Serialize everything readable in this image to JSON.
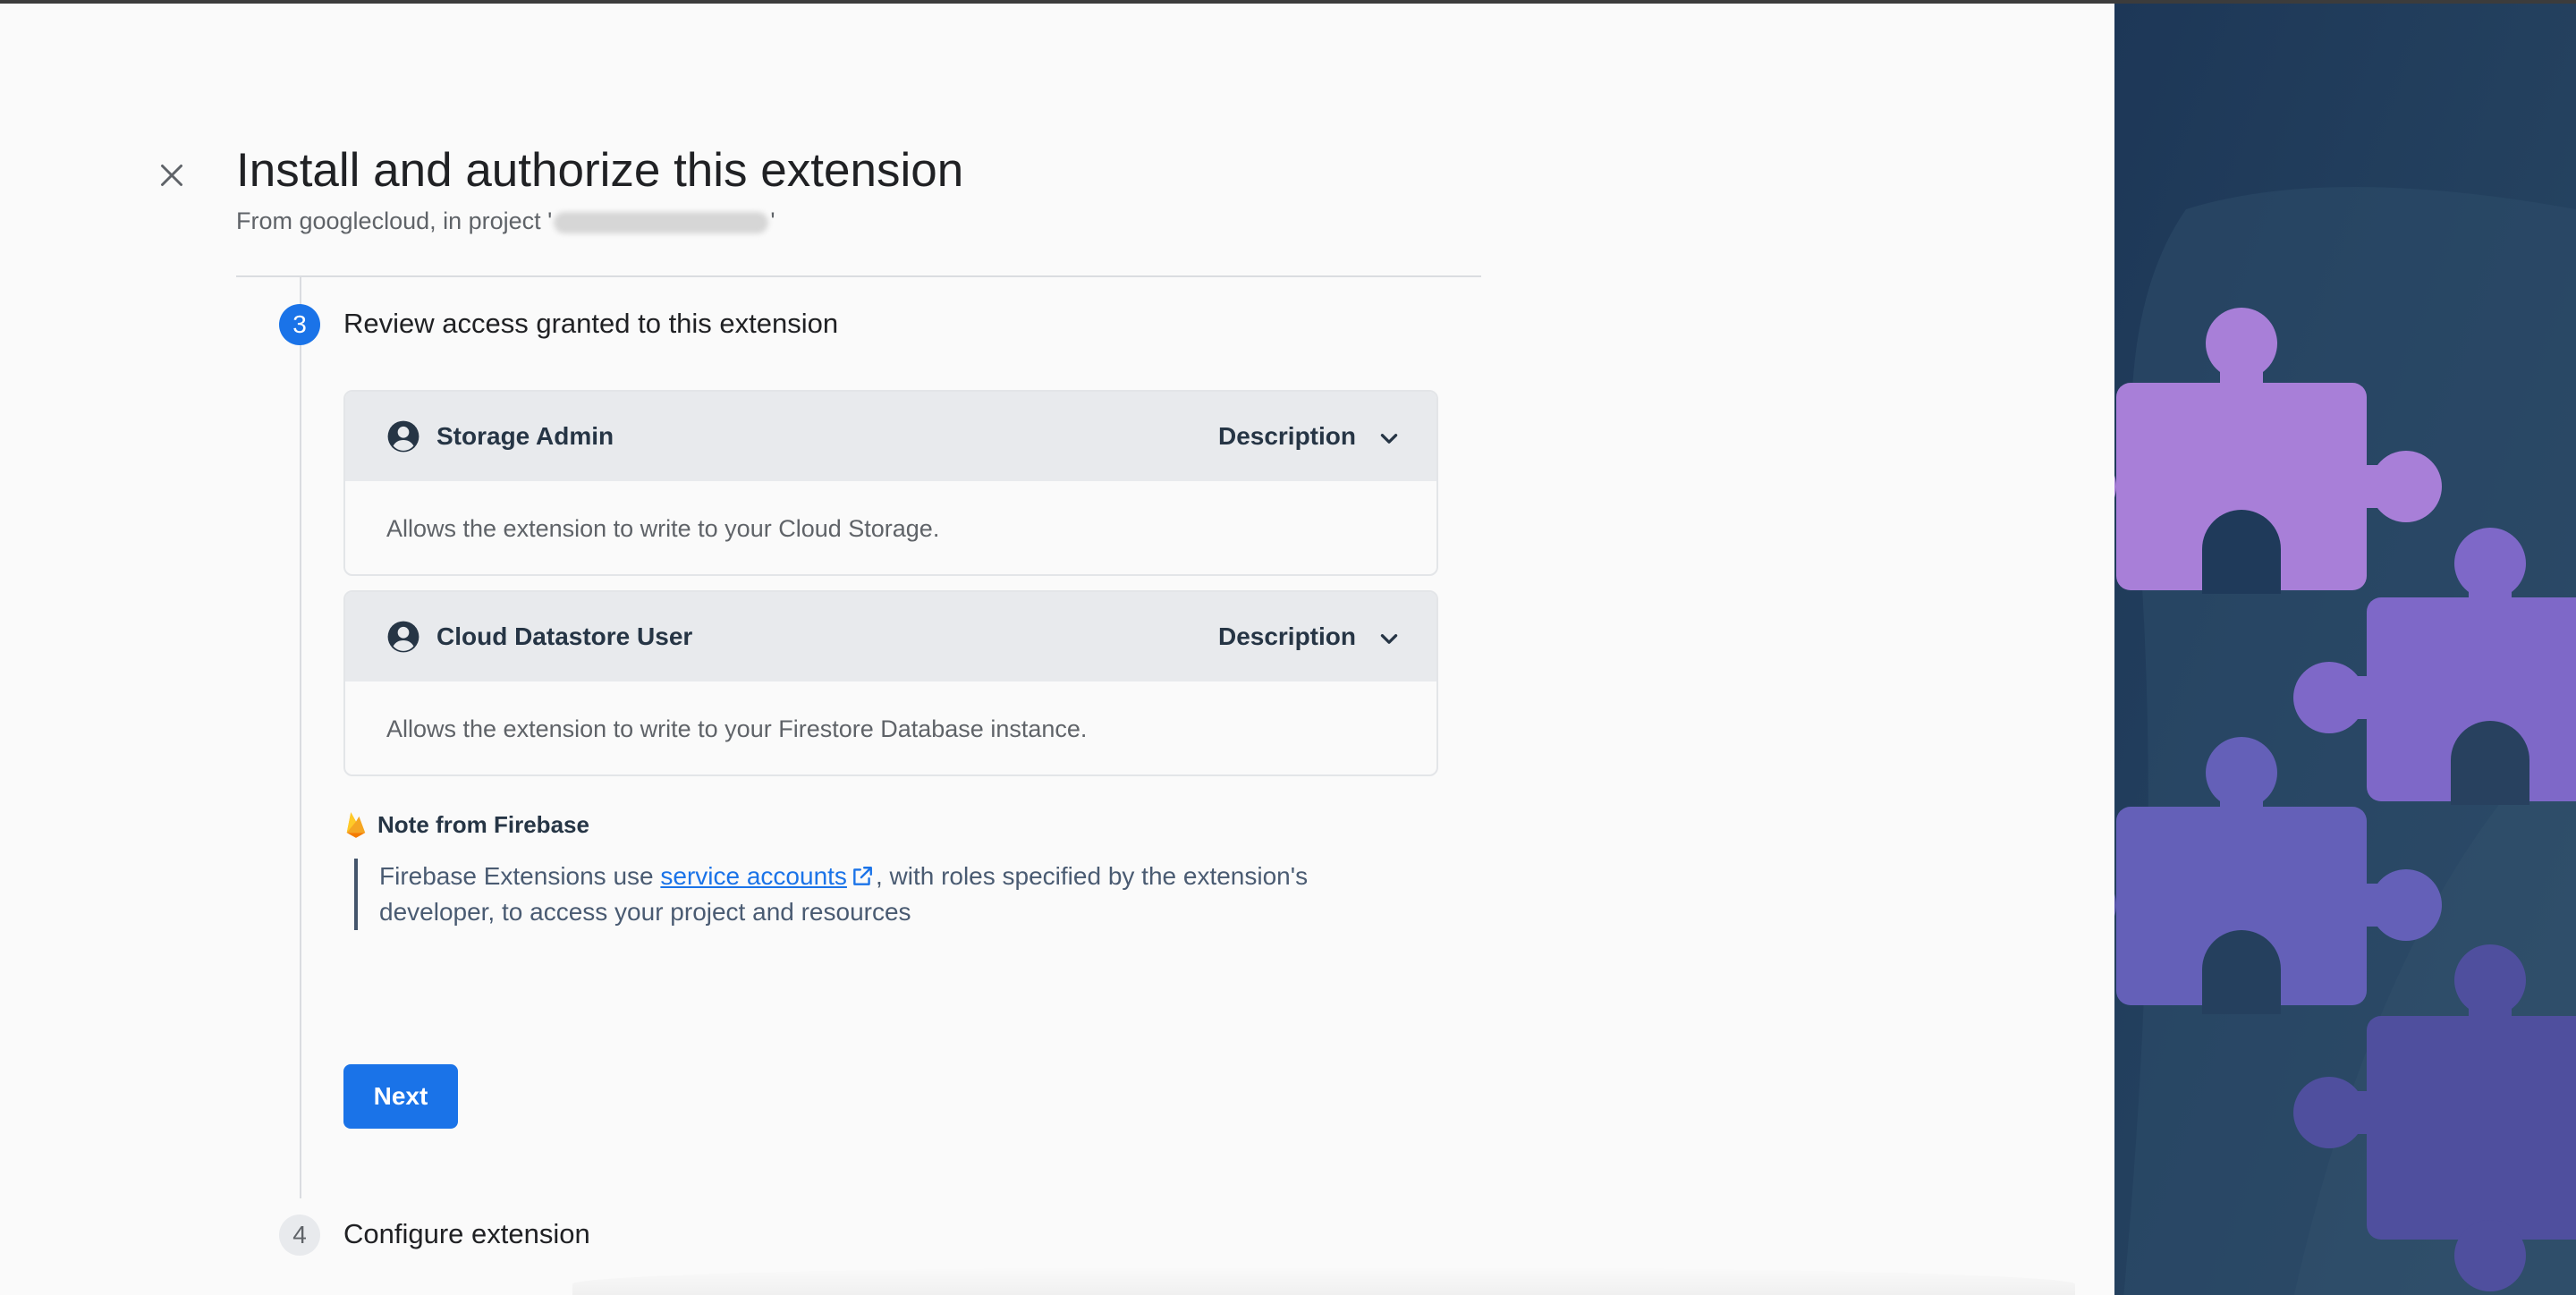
{
  "dialog": {
    "title": "Install and authorize this extension",
    "subtitle_prefix": "From googlecloud, in project '",
    "subtitle_suffix": "'",
    "close_icon": "close-icon"
  },
  "steps": {
    "current": {
      "number": "3",
      "title": "Review access granted to this extension"
    },
    "next": {
      "number": "4",
      "title": "Configure extension"
    }
  },
  "roles": [
    {
      "name": "Storage Admin",
      "toggle_label": "Description",
      "description": "Allows the extension to write to your Cloud Storage.",
      "icon": "account-circle-icon"
    },
    {
      "name": "Cloud Datastore User",
      "toggle_label": "Description",
      "description": "Allows the extension to write to your Firestore Database instance.",
      "icon": "account-circle-icon"
    }
  ],
  "note": {
    "heading": "Note from Firebase",
    "text_before": "Firebase Extensions use ",
    "link_text": "service accounts",
    "text_after": ", with roles specified by the extension's developer, to access your project and resources",
    "icon": "firebase-flame-icon"
  },
  "actions": {
    "next_label": "Next"
  },
  "colors": {
    "primary": "#1a73e8",
    "side_panel": "#1f3a5a",
    "puzzle_purple_light": "#a87fd8",
    "puzzle_purple": "#7e68c8",
    "puzzle_indigo": "#6460b8",
    "puzzle_indigo_dark": "#4f4f9e"
  }
}
